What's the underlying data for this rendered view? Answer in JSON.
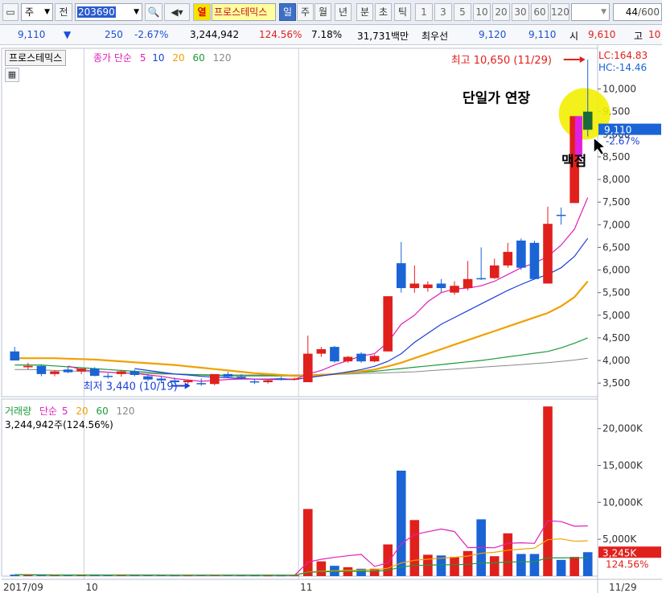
{
  "toolbar": {
    "period_select": "주",
    "prev_label": "전",
    "code": "203690",
    "flag_label": "열",
    "stock_name": "프로스테믹스",
    "periods": [
      "일",
      "주",
      "월",
      "년",
      "분",
      "초",
      "틱"
    ],
    "selected_period": "일",
    "minute_options": [
      "1",
      "3",
      "5",
      "10",
      "20",
      "30",
      "60",
      "120"
    ],
    "count": "44",
    "count_total": "/600"
  },
  "quote": {
    "price": "9,110",
    "change_arrow": "▼",
    "change": "250",
    "change_pct": "-2.67%",
    "volume": "3,244,942",
    "vol_ratio": "124.56%",
    "turnover_pct": "7.18%",
    "amount": "31,731백만",
    "best_ask_label": "최우선",
    "best_ask": "9,120",
    "best_bid": "9,110",
    "open_label": "시",
    "open": "9,610",
    "high_label": "고",
    "high": "10"
  },
  "price_panel": {
    "name": "프로스테믹스",
    "legend_title": "종가 단순",
    "ma_labels": [
      "5",
      "10",
      "20",
      "60",
      "120"
    ],
    "ma_colors": [
      "#e020b8",
      "#1a3fd6",
      "#f0a000",
      "#1b9b3a",
      "#888888"
    ],
    "lc": "LC:164.83",
    "hc": "HC:-14.46",
    "current_price": "9,110",
    "current_pct": "-2.67%",
    "high_note": "최고 10,650 (11/29)",
    "low_note": "최저 3,440 (10/19)",
    "annotation_upper": "단일가 연장",
    "annotation_lower": "맥점",
    "y_ticks": [
      "10,000",
      "9,500",
      "9,000",
      "8,500",
      "8,000",
      "7,500",
      "7,000",
      "6,500",
      "6,000",
      "5,500",
      "5,000",
      "4,500",
      "4,000",
      "3,500"
    ]
  },
  "volume_panel": {
    "title": "거래량",
    "legend_title": "단순",
    "ma_labels": [
      "5",
      "20",
      "60",
      "120"
    ],
    "info": "3,244,942주(124.56%)",
    "current_volume": "3,245K",
    "current_pct": "124.56%",
    "y_ticks": [
      "20,000K",
      "15,000K",
      "10,000K",
      "5,000K"
    ]
  },
  "x_axis": {
    "labels": [
      "2017/09",
      "10",
      "11"
    ],
    "end_label": "11/29"
  },
  "colors": {
    "up": "#e0201c",
    "down": "#1a64d6",
    "highlight": "#f2f000",
    "gap_bar": "#e020e0",
    "current_tag": "#1a64d6"
  },
  "chart_data": {
    "type": "candlestick",
    "candles": [
      {
        "o": 4200,
        "h": 4300,
        "l": 4000,
        "c": 4000
      },
      {
        "o": 3850,
        "h": 3950,
        "l": 3800,
        "c": 3880
      },
      {
        "o": 3880,
        "h": 3900,
        "l": 3650,
        "c": 3700
      },
      {
        "o": 3700,
        "h": 3780,
        "l": 3650,
        "c": 3760
      },
      {
        "o": 3800,
        "h": 3850,
        "l": 3720,
        "c": 3740
      },
      {
        "o": 3760,
        "h": 3830,
        "l": 3700,
        "c": 3820
      },
      {
        "o": 3820,
        "h": 3850,
        "l": 3650,
        "c": 3660
      },
      {
        "o": 3660,
        "h": 3720,
        "l": 3600,
        "c": 3640
      },
      {
        "o": 3700,
        "h": 3780,
        "l": 3640,
        "c": 3760
      },
      {
        "o": 3760,
        "h": 3800,
        "l": 3650,
        "c": 3680
      },
      {
        "o": 3650,
        "h": 3700,
        "l": 3550,
        "c": 3580
      },
      {
        "o": 3600,
        "h": 3650,
        "l": 3500,
        "c": 3560
      },
      {
        "o": 3560,
        "h": 3620,
        "l": 3480,
        "c": 3520
      },
      {
        "o": 3520,
        "h": 3580,
        "l": 3440,
        "c": 3560
      },
      {
        "o": 3500,
        "h": 3600,
        "l": 3440,
        "c": 3480
      },
      {
        "o": 3480,
        "h": 3600,
        "l": 3450,
        "c": 3700
      },
      {
        "o": 3700,
        "h": 3750,
        "l": 3620,
        "c": 3640
      },
      {
        "o": 3640,
        "h": 3700,
        "l": 3580,
        "c": 3600
      },
      {
        "o": 3540,
        "h": 3600,
        "l": 3480,
        "c": 3520
      },
      {
        "o": 3520,
        "h": 3580,
        "l": 3490,
        "c": 3560
      },
      {
        "o": 3600,
        "h": 3640,
        "l": 3560,
        "c": 3580
      },
      {
        "o": 3580,
        "h": 3620,
        "l": 3560,
        "c": 3600
      },
      {
        "o": 3520,
        "h": 4550,
        "l": 3520,
        "c": 4150
      },
      {
        "o": 4150,
        "h": 4300,
        "l": 4080,
        "c": 4250
      },
      {
        "o": 4300,
        "h": 4320,
        "l": 3950,
        "c": 3980
      },
      {
        "o": 3980,
        "h": 4100,
        "l": 3950,
        "c": 4080
      },
      {
        "o": 4150,
        "h": 4180,
        "l": 3950,
        "c": 3980
      },
      {
        "o": 3980,
        "h": 4130,
        "l": 3960,
        "c": 4100
      },
      {
        "o": 4200,
        "h": 5420,
        "l": 4200,
        "c": 5420
      },
      {
        "o": 6150,
        "h": 6620,
        "l": 5500,
        "c": 5600
      },
      {
        "o": 5600,
        "h": 6100,
        "l": 5500,
        "c": 5700
      },
      {
        "o": 5600,
        "h": 5750,
        "l": 5520,
        "c": 5680
      },
      {
        "o": 5700,
        "h": 5800,
        "l": 5500,
        "c": 5600
      },
      {
        "o": 5500,
        "h": 5750,
        "l": 5450,
        "c": 5650
      },
      {
        "o": 5600,
        "h": 6200,
        "l": 5550,
        "c": 5800
      },
      {
        "o": 5820,
        "h": 6500,
        "l": 5780,
        "c": 5800
      },
      {
        "o": 5820,
        "h": 6250,
        "l": 5800,
        "c": 6100
      },
      {
        "o": 6100,
        "h": 6600,
        "l": 6050,
        "c": 6400
      },
      {
        "o": 6650,
        "h": 6700,
        "l": 6000,
        "c": 6050
      },
      {
        "o": 6600,
        "h": 6650,
        "l": 5800,
        "c": 5800
      },
      {
        "o": 5700,
        "h": 7400,
        "l": 5700,
        "c": 7020
      },
      {
        "o": 7220,
        "h": 7380,
        "l": 7000,
        "c": 7200
      },
      {
        "o": 7480,
        "h": 9400,
        "l": 7480,
        "c": 9400
      },
      {
        "o": 9500,
        "h": 10650,
        "l": 8950,
        "c": 9100
      }
    ],
    "volume_k": [
      200,
      150,
      140,
      140,
      130,
      150,
      130,
      120,
      130,
      120,
      110,
      110,
      100,
      100,
      110,
      120,
      110,
      100,
      100,
      90,
      90,
      100,
      9100,
      2000,
      1400,
      1200,
      1000,
      1000,
      4300,
      14300,
      7600,
      2900,
      2800,
      2600,
      3400,
      7700,
      2700,
      5800,
      3000,
      3000,
      23000,
      2200,
      2600,
      3245
    ],
    "ma_price": {
      "ma5": [
        null,
        null,
        null,
        null,
        3880,
        3800,
        3760,
        3740,
        3720,
        3720,
        3680,
        3650,
        3600,
        3570,
        3540,
        3560,
        3580,
        3590,
        3590,
        3590,
        3600,
        3580,
        3700,
        3780,
        3900,
        4000,
        4100,
        4150,
        4400,
        4800,
        5000,
        5300,
        5500,
        5580,
        5600,
        5650,
        5750,
        5900,
        6050,
        6150,
        6300,
        6550,
        6900,
        7600
      ],
      "ma10": [
        null,
        null,
        null,
        null,
        null,
        null,
        null,
        null,
        null,
        3820,
        3780,
        3740,
        3700,
        3680,
        3650,
        3630,
        3620,
        3600,
        3590,
        3580,
        3580,
        3580,
        3620,
        3660,
        3700,
        3750,
        3800,
        3870,
        3980,
        4150,
        4400,
        4600,
        4800,
        4950,
        5100,
        5250,
        5400,
        5550,
        5680,
        5800,
        5900,
        6050,
        6300,
        6700
      ],
      "ma20": [
        4050,
        4050,
        4050,
        4050,
        4040,
        4030,
        4020,
        4000,
        3980,
        3960,
        3940,
        3920,
        3900,
        3870,
        3840,
        3810,
        3780,
        3750,
        3720,
        3700,
        3680,
        3660,
        3660,
        3680,
        3700,
        3730,
        3760,
        3800,
        3870,
        3950,
        4050,
        4150,
        4250,
        4350,
        4450,
        4550,
        4650,
        4750,
        4850,
        4950,
        5050,
        5200,
        5400,
        5750
      ],
      "ma60": [
        3900,
        3900,
        3900,
        3880,
        3860,
        3840,
        3820,
        3800,
        3780,
        3760,
        3740,
        3720,
        3700,
        3690,
        3680,
        3670,
        3660,
        3660,
        3660,
        3660,
        3660,
        3660,
        3670,
        3690,
        3700,
        3720,
        3740,
        3760,
        3790,
        3820,
        3850,
        3880,
        3910,
        3940,
        3970,
        4000,
        4040,
        4080,
        4120,
        4160,
        4200,
        4280,
        4380,
        4500
      ],
      "ma120": [
        3800,
        3800,
        3790,
        3780,
        3770,
        3760,
        3750,
        3740,
        3730,
        3720,
        3710,
        3700,
        3700,
        3690,
        3690,
        3680,
        3680,
        3680,
        3680,
        3680,
        3680,
        3680,
        3680,
        3690,
        3690,
        3700,
        3710,
        3720,
        3730,
        3740,
        3750,
        3770,
        3790,
        3810,
        3830,
        3850,
        3870,
        3890,
        3910,
        3930,
        3950,
        3980,
        4010,
        4050
      ]
    },
    "ylim_price": [
      3200,
      10900
    ],
    "ylim_volume": [
      0,
      24000
    ]
  }
}
